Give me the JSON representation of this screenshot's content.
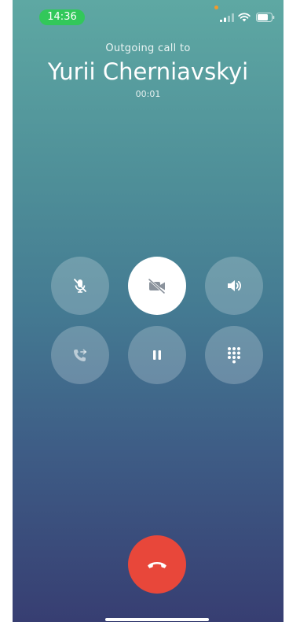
{
  "status_bar": {
    "time": "14:36",
    "time_pill_color": "#32c85a",
    "icons": [
      "signal-icon",
      "wifi-icon",
      "battery-icon"
    ]
  },
  "call": {
    "caption": "Outgoing call to",
    "callee_name": "Yurii Cherniavskyi",
    "duration": "00:01"
  },
  "controls": [
    {
      "name": "mute",
      "icon": "microphone-muted-icon",
      "active": false
    },
    {
      "name": "video",
      "icon": "video-off-icon",
      "active": true
    },
    {
      "name": "speaker",
      "icon": "speaker-icon",
      "active": false
    },
    {
      "name": "transfer",
      "icon": "call-transfer-icon",
      "active": false
    },
    {
      "name": "hold",
      "icon": "pause-icon",
      "active": false
    },
    {
      "name": "keypad",
      "icon": "keypad-icon",
      "active": false
    }
  ],
  "end_call": {
    "icon": "hang-up-icon",
    "color": "#e8473a"
  },
  "colors": {
    "gradient_top": "#5ea8a3",
    "gradient_bottom": "#373e72",
    "control_background": "rgba(255,255,255,0.22)",
    "active_control_background": "#ffffff"
  }
}
